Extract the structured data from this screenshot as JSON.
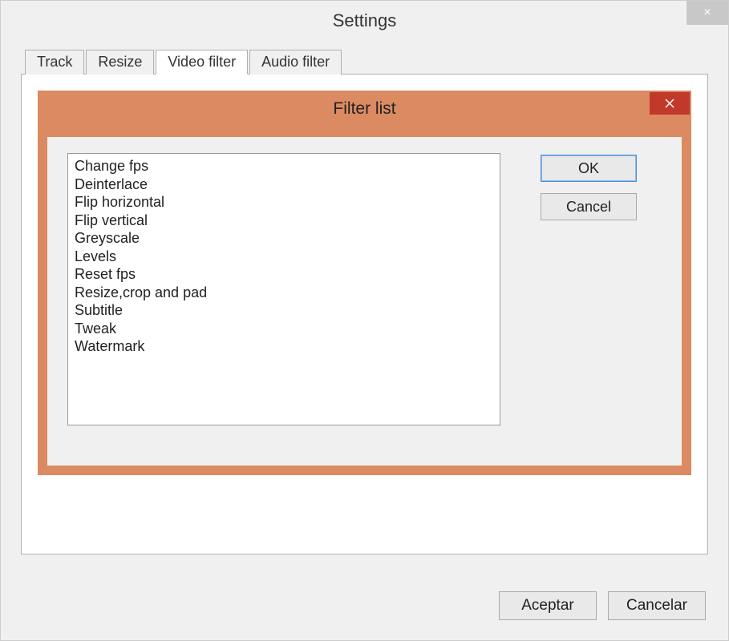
{
  "window": {
    "title": "Settings",
    "close_icon": "×"
  },
  "tabs": [
    {
      "label": "Track",
      "active": false
    },
    {
      "label": "Resize",
      "active": false
    },
    {
      "label": "Video filter",
      "active": true
    },
    {
      "label": "Audio filter",
      "active": false
    }
  ],
  "dialog": {
    "title": "Filter list",
    "ok_label": "OK",
    "cancel_label": "Cancel",
    "items": [
      "Change fps",
      "Deinterlace",
      "Flip horizontal",
      "Flip vertical",
      "Greyscale",
      "Levels",
      "Reset fps",
      "Resize,crop and pad",
      "Subtitle",
      "Tweak",
      "Watermark"
    ]
  },
  "footer": {
    "accept_label": "Aceptar",
    "cancel_label": "Cancelar"
  }
}
